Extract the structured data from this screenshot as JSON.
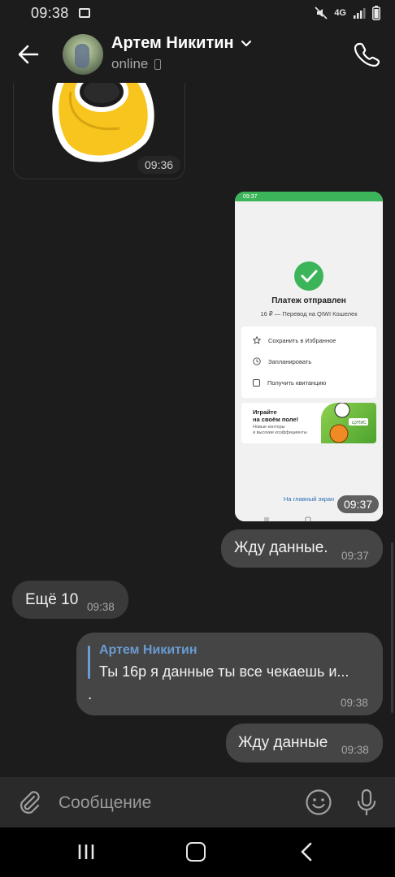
{
  "status_bar": {
    "time": "09:38",
    "network": "4G"
  },
  "header": {
    "contact_name": "Артем Никитин",
    "status": "online"
  },
  "messages": {
    "sticker": {
      "time": "09:36"
    },
    "payment_screenshot": {
      "time": "09:37",
      "inner_status_time": "09:37",
      "inner_title": "Платеж отправлен",
      "inner_subtitle": "16 ₽ — Перевод на QIWI Кошелек",
      "inner_actions": [
        "Сохранить в Избранное",
        "Запланировать",
        "Получить квитанцию"
      ],
      "promo_title_line1": "Играйте",
      "promo_title_line2": "на своём поле!",
      "promo_sub_line1": "Новые конторы",
      "promo_sub_line2": "и высокие коэффициенты",
      "promo_badge": "ЦУПИС",
      "inner_link": "На главный экран"
    },
    "out1": {
      "text": "Жду данные.",
      "time": "09:37"
    },
    "in1": {
      "text": "Ещё 10",
      "time": "09:38"
    },
    "out2": {
      "reply_author": "Артем Никитин",
      "reply_text": "Ты 16р я данные ты все чекаешь и...",
      "text": ".",
      "time": "09:38"
    },
    "out3": {
      "text": "Жду данные",
      "time": "09:38"
    }
  },
  "input": {
    "placeholder": "Сообщение"
  },
  "colors": {
    "background": "#1c1c1c",
    "outgoing_bubble": "#454545",
    "incoming_bubble": "#3a3a3a",
    "reply_accent": "#6a9bd1",
    "qiwi_green": "#3cb55a"
  }
}
